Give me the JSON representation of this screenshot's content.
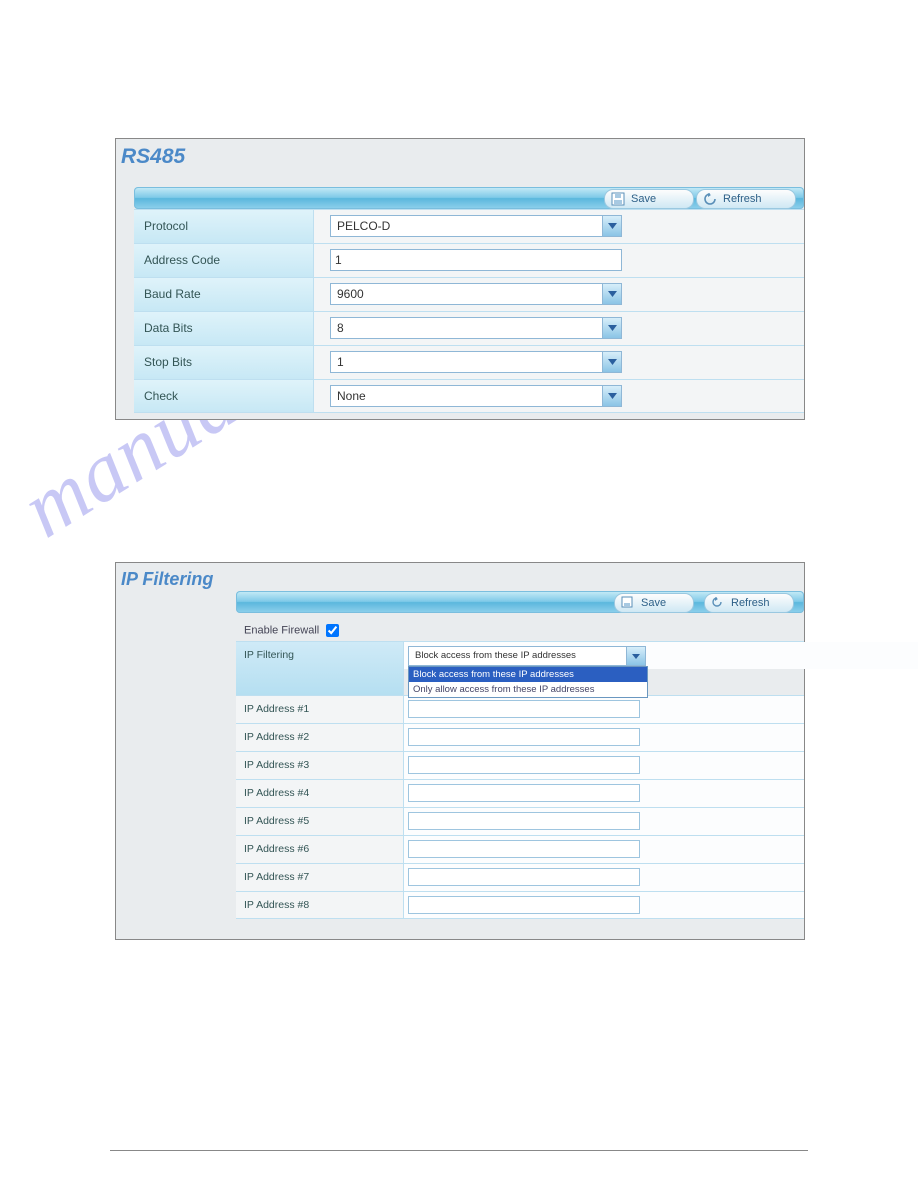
{
  "watermark": "manualshive.com",
  "rs485": {
    "title": "RS485",
    "toolbar": {
      "save": "Save",
      "refresh": "Refresh"
    },
    "rows": [
      {
        "label": "Protocol",
        "type": "select",
        "value": "PELCO-D"
      },
      {
        "label": "Address Code",
        "type": "text",
        "value": "1"
      },
      {
        "label": "Baud Rate",
        "type": "select",
        "value": "9600"
      },
      {
        "label": "Data Bits",
        "type": "select",
        "value": "8"
      },
      {
        "label": "Stop Bits",
        "type": "select",
        "value": "1"
      },
      {
        "label": "Check",
        "type": "select",
        "value": "None"
      }
    ]
  },
  "ipf": {
    "title": "IP Filtering",
    "toolbar": {
      "save": "Save",
      "refresh": "Refresh"
    },
    "enable_label": "Enable Firewall",
    "enable_checked": true,
    "filter_label": "IP Filtering",
    "filter_value": "Block access from these IP addresses",
    "filter_options": [
      "Block access from these IP addresses",
      "Only allow access from these IP addresses"
    ],
    "addr_labels": [
      "IP Address #1",
      "IP Address #2",
      "IP Address #3",
      "IP Address #4",
      "IP Address #5",
      "IP Address #6",
      "IP Address #7",
      "IP Address #8"
    ],
    "addr_values": [
      "",
      "",
      "",
      "",
      "",
      "",
      "",
      ""
    ]
  }
}
